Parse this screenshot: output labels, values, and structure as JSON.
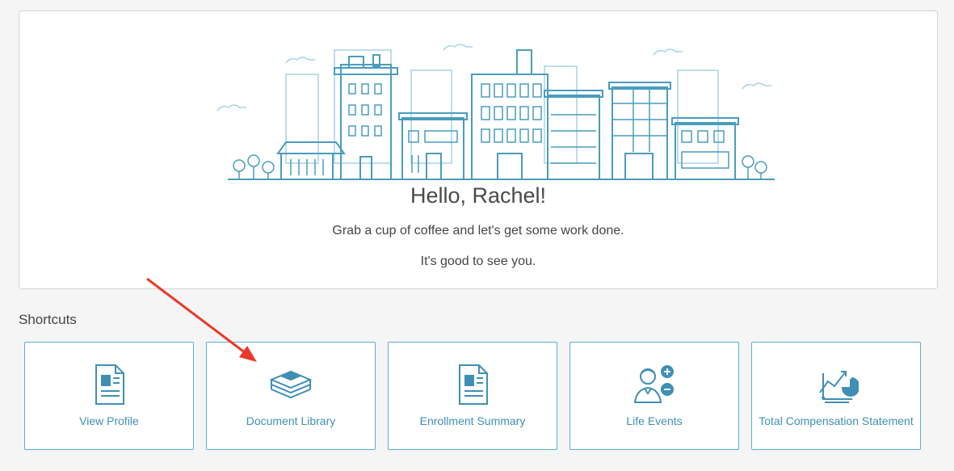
{
  "welcome": {
    "greeting": "Hello, Rachel!",
    "line1": "Grab a cup of coffee and let's get some work done.",
    "line2": "It's good to see you."
  },
  "shortcuts": {
    "heading": "Shortcuts",
    "items": [
      {
        "label": "View Profile",
        "icon": "profile-document-icon"
      },
      {
        "label": "Document Library",
        "icon": "stacked-books-icon"
      },
      {
        "label": "Enrollment Summary",
        "icon": "enrollment-document-icon"
      },
      {
        "label": "Life Events",
        "icon": "person-plus-minus-icon"
      },
      {
        "label": "Total Compensation Statement",
        "icon": "compensation-chart-icon"
      }
    ]
  },
  "colors": {
    "accent": "#3f8fb4",
    "tile_border": "#5aaed2",
    "illustration_stroke": "#4a9cbd",
    "illustration_light": "#a7d3e2",
    "annotation_arrow": "#e8392b"
  }
}
